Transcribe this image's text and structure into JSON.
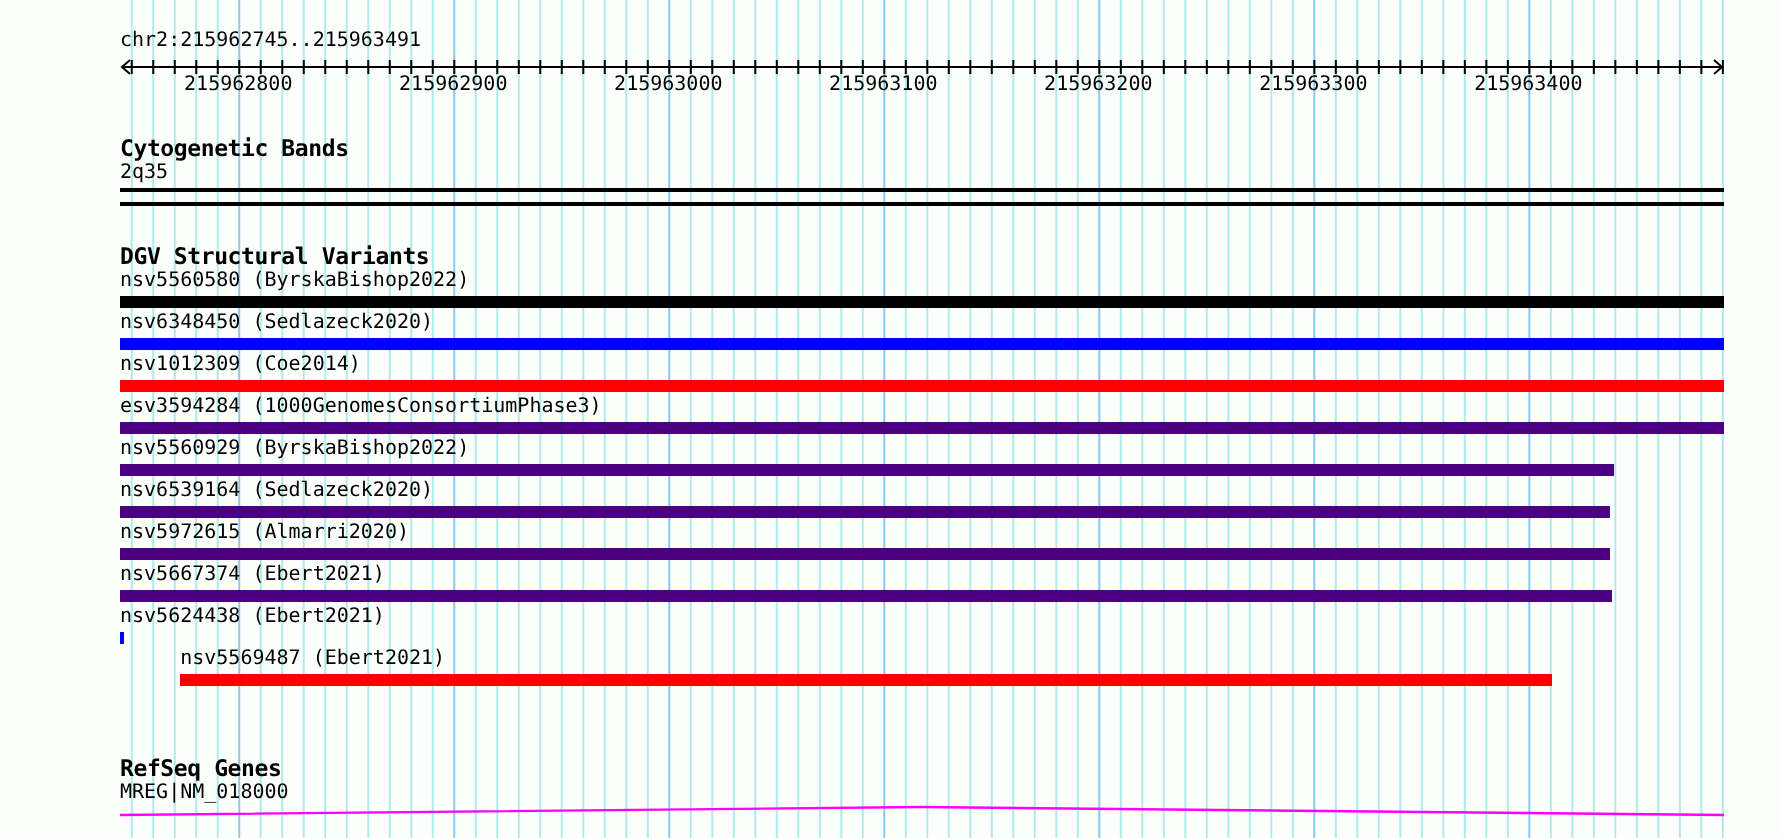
{
  "ruler": {
    "location": "chr2:215962745..215963491",
    "ticks": [
      "215962800",
      "215962900",
      "215963000",
      "215963100",
      "215963200",
      "215963300",
      "215963400"
    ]
  },
  "tracks": [
    {
      "kind": "cytoband",
      "title": "Cytogenetic Bands",
      "features": [
        {
          "label": "2q35"
        }
      ]
    },
    {
      "kind": "variants",
      "title": "DGV Structural Variants",
      "features": [
        {
          "label": "nsv5560580 (ByrskaBishop2022)",
          "color": "#000000"
        },
        {
          "label": "nsv6348450 (Sedlazeck2020)",
          "color": "#0000ff"
        },
        {
          "label": "nsv1012309 (Coe2014)",
          "color": "#ff0000"
        },
        {
          "label": "esv3594284 (1000GenomesConsortiumPhase3)",
          "color": "#4b0082"
        },
        {
          "label": "nsv5560929 (ByrskaBishop2022)",
          "color": "#4b0082"
        },
        {
          "label": "nsv6539164 (Sedlazeck2020)",
          "color": "#4b0082"
        },
        {
          "label": "nsv5972615 (Almarri2020)",
          "color": "#4b0082"
        },
        {
          "label": "nsv5667374 (Ebert2021)",
          "color": "#4b0082"
        },
        {
          "label": "nsv5624438 (Ebert2021)",
          "color": "#0000ff"
        },
        {
          "label": "nsv5569487 (Ebert2021)",
          "color": "#ff0000"
        }
      ]
    },
    {
      "kind": "gene",
      "title": "RefSeq Genes",
      "features": [
        {
          "label": "MREG|NM_018000"
        }
      ]
    }
  ]
}
